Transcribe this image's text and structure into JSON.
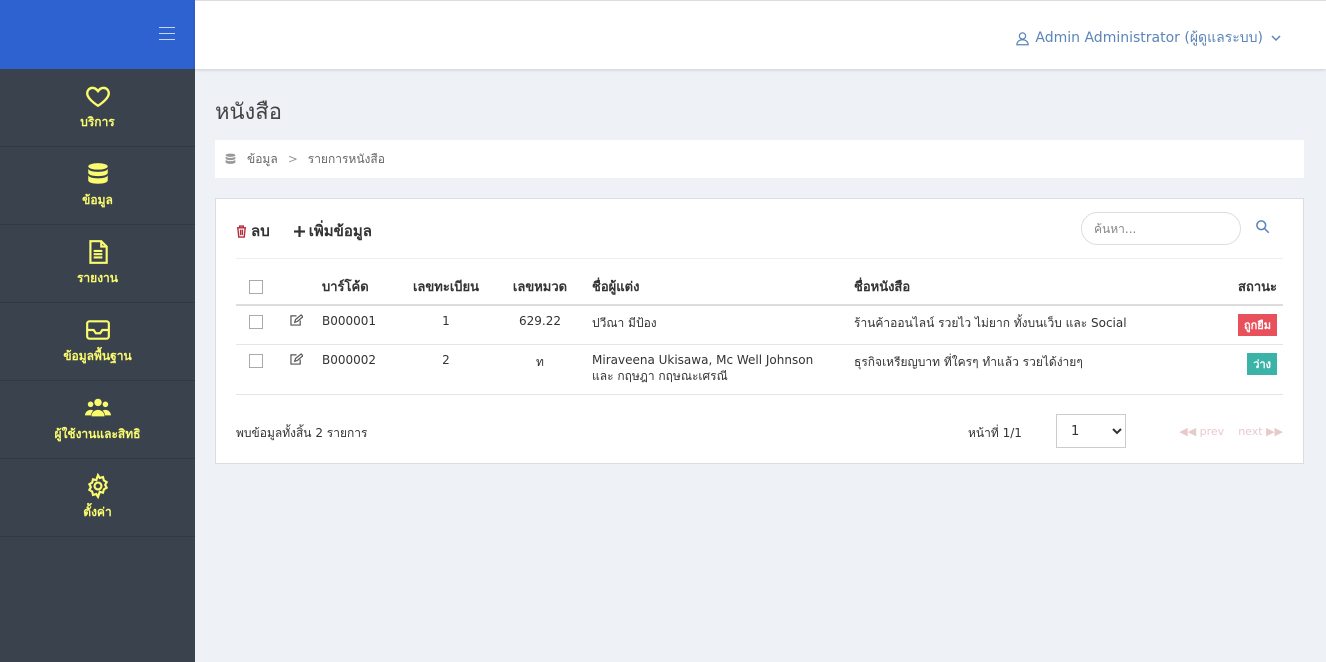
{
  "sidebar": {
    "items": [
      {
        "label": "บริการ",
        "icon": "heart-icon"
      },
      {
        "label": "ข้อมูล",
        "icon": "database-icon"
      },
      {
        "label": "รายงาน",
        "icon": "file-text-icon"
      },
      {
        "label": "ข้อมูลพื้นฐาน",
        "icon": "inbox-icon"
      },
      {
        "label": "ผู้ใช้งานและสิทธิ",
        "icon": "users-icon"
      },
      {
        "label": "ตั้งค่า",
        "icon": "gear-icon"
      }
    ]
  },
  "header": {
    "user": "Admin Administrator (ผู้ดูแลระบบ)"
  },
  "page": {
    "title": "หนังสือ"
  },
  "breadcrumb": {
    "items": [
      "ข้อมูล",
      "รายการหนังสือ"
    ]
  },
  "toolbar": {
    "delete_label": "ลบ",
    "add_label": "เพิ่มข้อมูล",
    "search_placeholder": "ค้นหา..."
  },
  "table": {
    "headers": [
      "บาร์โค้ด",
      "เลขทะเบียน",
      "เลขหมวด",
      "ชื่อผู้แต่ง",
      "ชื่อหนังสือ",
      "สถานะ"
    ],
    "rows": [
      {
        "barcode": "B000001",
        "reg_no": "1",
        "category": "629.22",
        "author": "ปวีณา มีป้อง",
        "author2": "",
        "title": "ร้านค้าออนไลน์ รวยไว ไม่ยาก ทั้งบนเว็บ และ Social",
        "status": "ถูกยืม"
      },
      {
        "barcode": "B000002",
        "reg_no": "2",
        "category": "ท",
        "author": "Miraveena Ukisawa, Mc Well Johnson",
        "author2": "และ กฤษฎา กฤษณะเศรณี",
        "title": "ธุรกิจเหรียญบาท ที่ใครๆ ทำแล้ว รวยได้ง่ายๆ",
        "status": "ว่าง"
      }
    ]
  },
  "footer": {
    "total_text": "พบข้อมูลทั้งสิ้น 2 รายการ",
    "page_text": "หน้าที่ 1/1",
    "page_select": "1",
    "prev": "◀◀ prev",
    "next": "next ▶▶"
  },
  "colors": {
    "brand": "#2f62d1",
    "sidebar": "#3a424d",
    "nav_text": "#fbfb6e",
    "status_borrowed": "#e8505b",
    "status_available": "#3bb3a6"
  }
}
